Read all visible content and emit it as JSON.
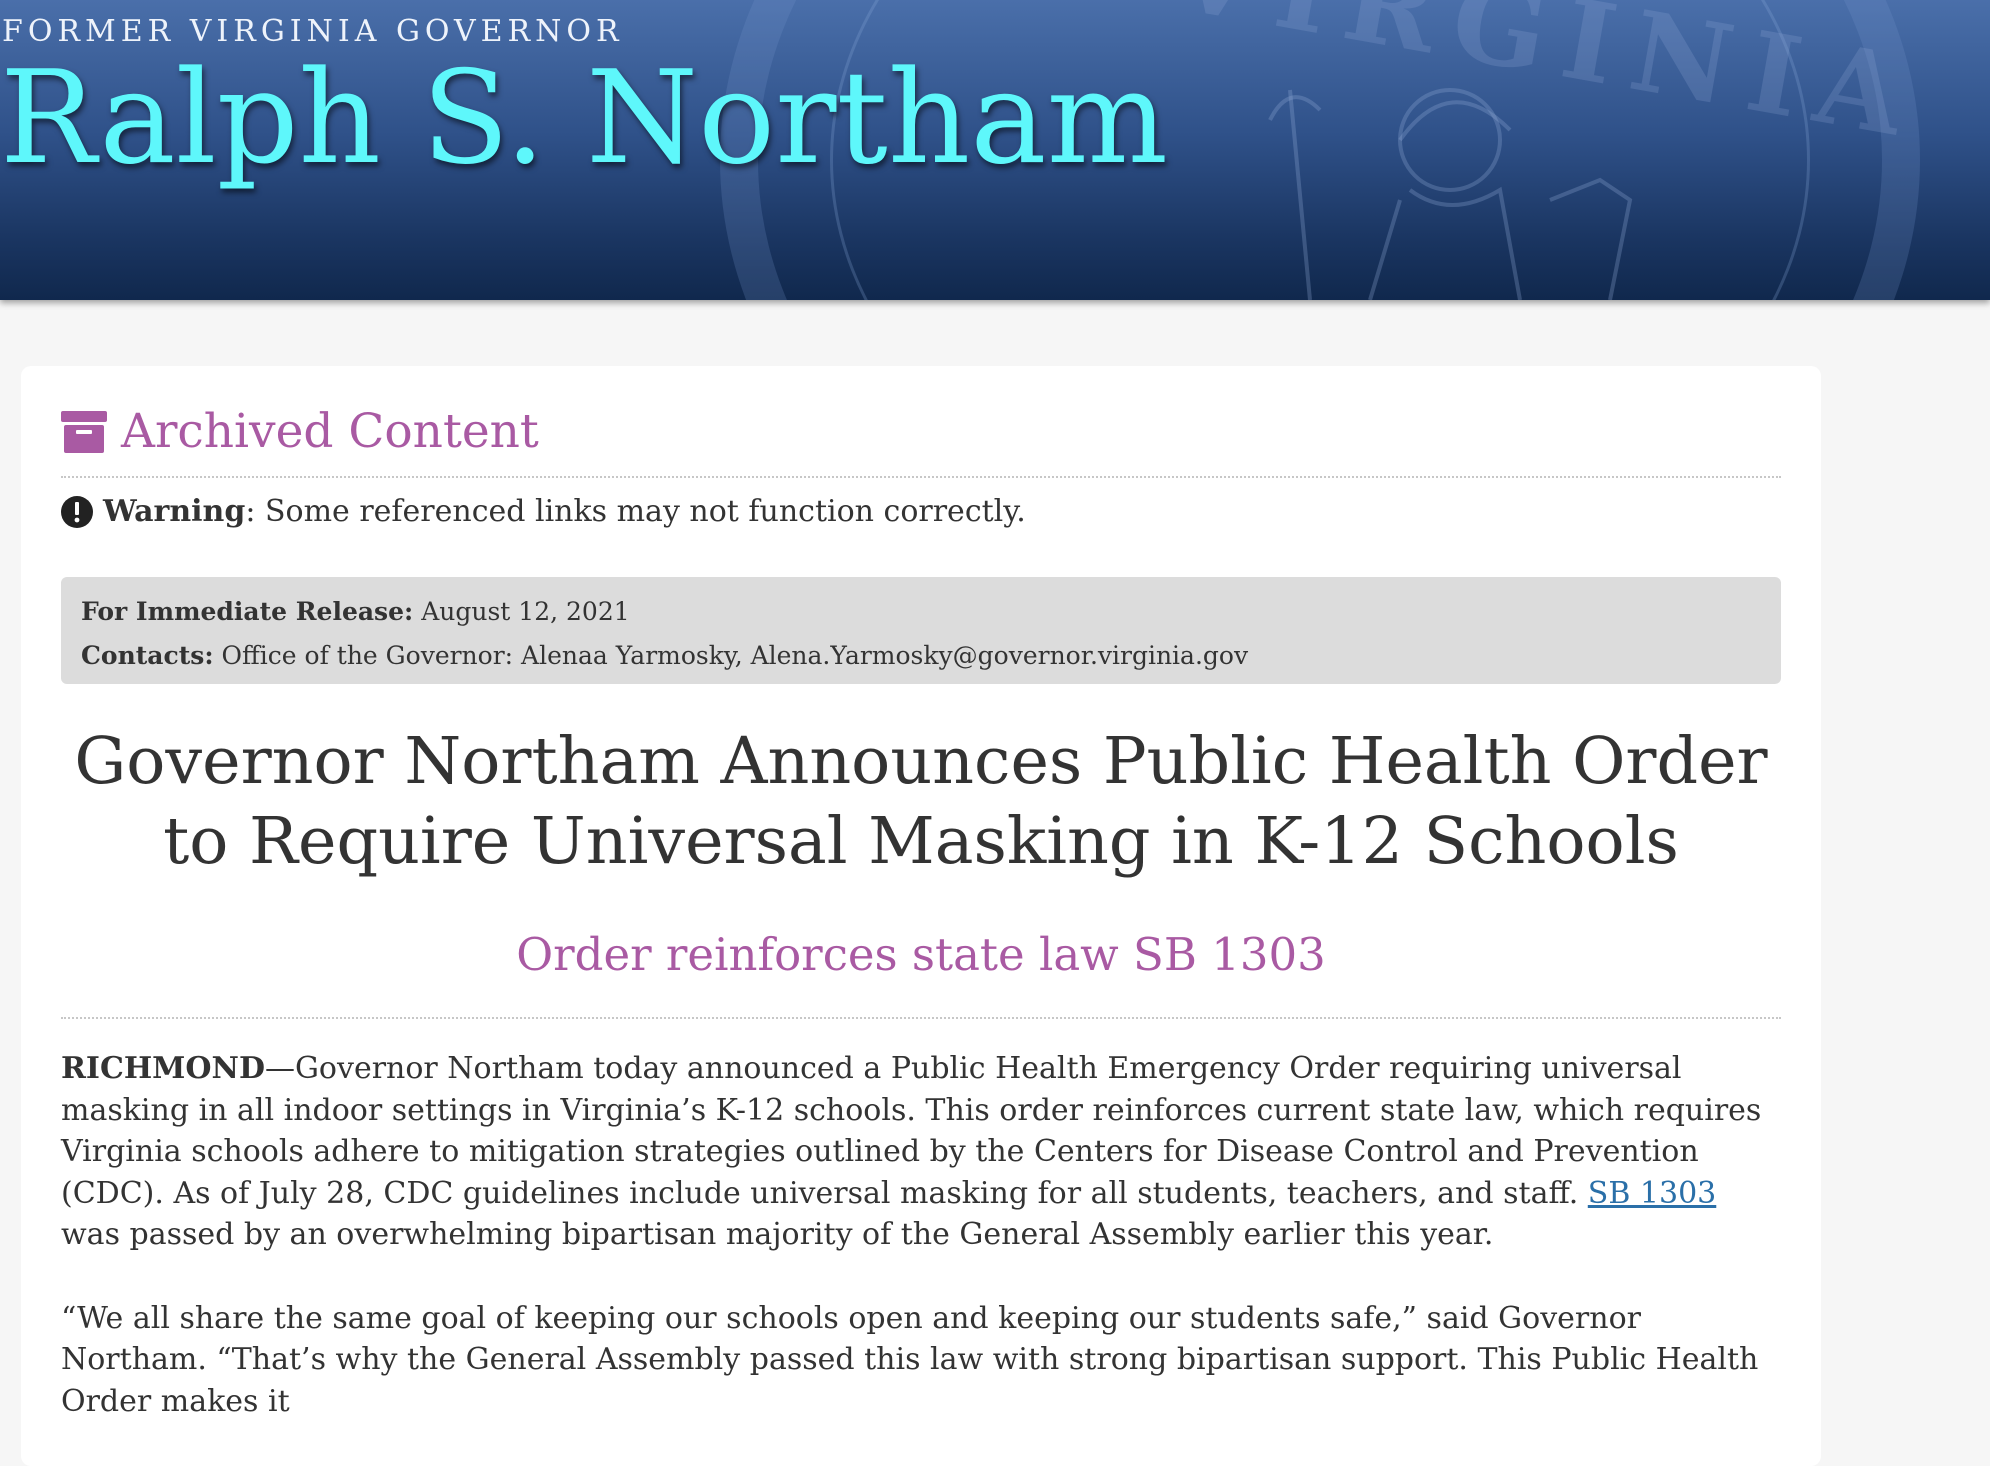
{
  "header": {
    "kicker": "FORMER VIRGINIA GOVERNOR",
    "name": "Ralph S. Northam",
    "seal_text": "VIRGINIA"
  },
  "archive": {
    "icon": "archive-box-icon",
    "title": "Archived Content",
    "warning_icon": "exclamation-circle-icon",
    "warning_label": "Warning",
    "warning_text": ": Some referenced links may not function correctly."
  },
  "release": {
    "release_label": "For Immediate Release:",
    "release_date": "August 12, 2021",
    "contacts_label": "Contacts:",
    "contacts_value": "Office of the Governor: Alenaa Yarmosky, Alena.Yarmosky@governor.virginia.gov"
  },
  "article": {
    "headline": "Governor Northam Announces Public Health Order to Require Universal Masking in K-12 Schools",
    "subhead": "Order reinforces state law SB 1303",
    "dateline": "RICHMOND",
    "para1_a": "—Governor Northam today announced a Public Health Emergency Order requiring universal masking in all indoor settings in Virginia’s K-12 schools. This order reinforces current state law, which requires Virginia schools adhere to mitigation strategies outlined by the Centers for Disease Control and Prevention (CDC). As of July 28, CDC guidelines include universal masking for all students, teachers, and staff. ",
    "para1_link": "SB 1303",
    "para1_b": " was passed by an overwhelming bipartisan majority of the General Assembly earlier this year.",
    "para2": "“We all share the same goal of keeping our schools open and keeping our students safe,” said Governor Northam. “That’s why the General Assembly passed this law with strong bipartisan support. This Public Health Order makes it"
  },
  "colors": {
    "accent": "#a95aa3",
    "name": "#5ef7fb",
    "link": "#2a6fa8",
    "banner_dark": "#10284d"
  }
}
